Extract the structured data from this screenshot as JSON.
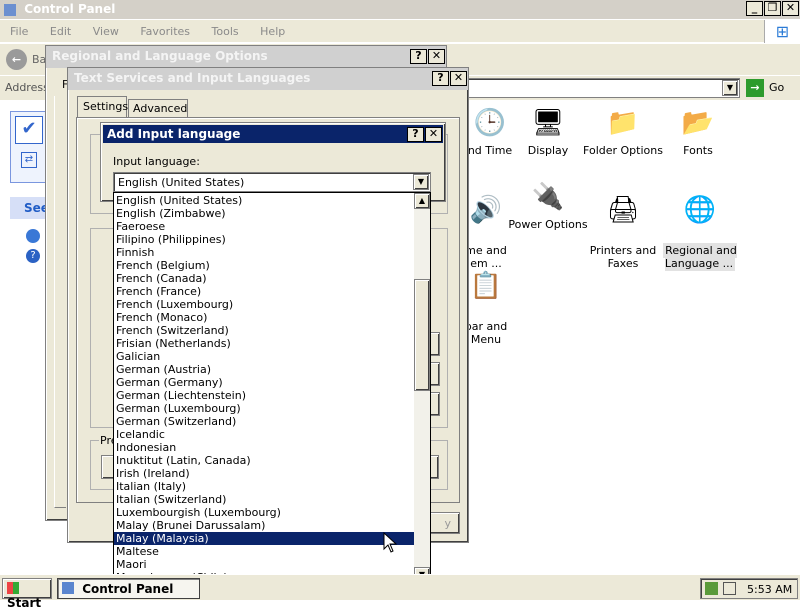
{
  "control_panel": {
    "title": "Control Panel",
    "menu": [
      "File",
      "Edit",
      "View",
      "Favorites",
      "Tools",
      "Help"
    ],
    "back_label": "Ba",
    "address_label": "Address",
    "go_label": "Go",
    "see_label": "See",
    "icons": [
      {
        "label": "nd Time",
        "glyph": "🕒"
      },
      {
        "label": "Display",
        "glyph": "🖥"
      },
      {
        "label": "Folder Options",
        "glyph": "📁"
      },
      {
        "label": "Fonts",
        "glyph": "📂"
      },
      {
        "label": "me and\nem ...",
        "glyph": "🔊"
      },
      {
        "label": "Power Options",
        "glyph": "🔌"
      },
      {
        "label": "Printers and\nFaxes",
        "glyph": "🖨"
      },
      {
        "label": "Regional and\nLanguage ...",
        "glyph": "🌐"
      },
      {
        "label": "bar and\nMenu",
        "glyph": "📋"
      }
    ]
  },
  "regional_dialog": {
    "title": "Regional and Language Options",
    "help": "?",
    "close": "✕",
    "partial_f": "F"
  },
  "text_services_dialog": {
    "title": "Text Services and Input Languages",
    "tabs": [
      "Settings",
      "Advanced"
    ],
    "pre_label": "Pre",
    "apply_fragment": "y"
  },
  "add_input_dialog": {
    "title": "Add Input language",
    "input_label": "Input language:",
    "selected_value": "English (United States)",
    "list": [
      "English (United States)",
      "English (Zimbabwe)",
      "Faeroese",
      "Filipino (Philippines)",
      "Finnish",
      "French (Belgium)",
      "French (Canada)",
      "French (France)",
      "French (Luxembourg)",
      "French (Monaco)",
      "French (Switzerland)",
      "Frisian (Netherlands)",
      "Galician",
      "German (Austria)",
      "German (Germany)",
      "German (Liechtenstein)",
      "German (Luxembourg)",
      "German (Switzerland)",
      "Icelandic",
      "Indonesian",
      "Inuktitut (Latin, Canada)",
      "Irish (Ireland)",
      "Italian (Italy)",
      "Italian (Switzerland)",
      "Luxembourgish (Luxembourg)",
      "Malay (Brunei Darussalam)",
      "Malay (Malaysia)",
      "Maltese",
      "Maori",
      "Mapudungun (Chile)"
    ],
    "highlighted_index": 26
  },
  "taskbar": {
    "start_label": "Start",
    "task_label": "Control Panel",
    "clock": "5:53 AM"
  },
  "colors": {
    "title_active": "#0a246a",
    "selection": "#0a246a",
    "chrome": "#ece9d8"
  }
}
